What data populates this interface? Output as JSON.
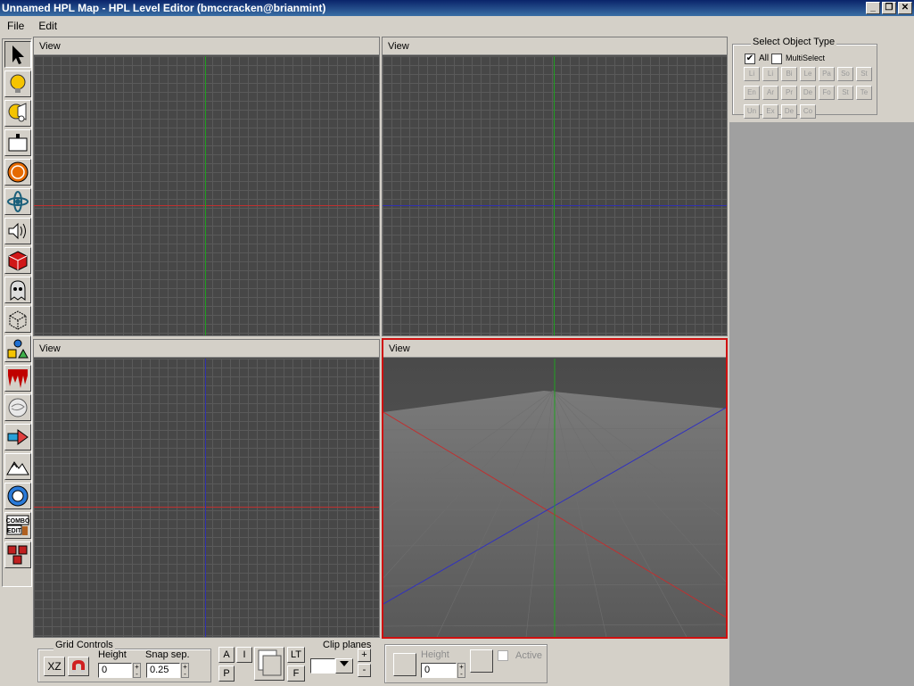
{
  "window": {
    "title": "Unnamed HPL Map - HPL Level Editor  (bmccracken@brianmint)"
  },
  "menu": {
    "items": [
      "File",
      "Edit"
    ]
  },
  "toolbox": {
    "tools": [
      "select",
      "light",
      "spotlight",
      "billboard",
      "particle-flare",
      "particle-system",
      "sound",
      "static-object",
      "entity",
      "area",
      "primitive",
      "decal",
      "fog",
      "arrow",
      "terrain",
      "combo",
      "compound"
    ]
  },
  "viewports": [
    {
      "label": "View",
      "type": "orthographic",
      "axes": {
        "horizontal": "#c03030",
        "vertical": "#20a020"
      }
    },
    {
      "label": "View",
      "type": "orthographic",
      "axes": {
        "horizontal": "#3030b0",
        "vertical": "#20a020"
      }
    },
    {
      "label": "View",
      "type": "orthographic",
      "axes": {
        "horizontal": "#c03030",
        "vertical": "#3030b0"
      }
    },
    {
      "label": "View",
      "type": "perspective",
      "selected": true
    }
  ],
  "object_type": {
    "title": "Select Object Type",
    "all_label": "All",
    "all_checked": true,
    "multiselect_label": "MultiSelect",
    "multiselect_checked": false,
    "buttons_row1": [
      "Li",
      "Li",
      "Bi",
      "Le",
      "Pa",
      "So",
      "St"
    ],
    "buttons_row2": [
      "En",
      "Ar",
      "Pr",
      "De",
      "Fo",
      "St",
      "Te"
    ],
    "buttons_row3": [
      "Un",
      "Ex",
      "De",
      "Co"
    ]
  },
  "grid_controls": {
    "title": "Grid Controls",
    "plane_button": "XZ",
    "height_label": "Height",
    "height_value": "0",
    "snap_label": "Snap sep.",
    "snap_value": "0.25",
    "btn_a": "A",
    "btn_i": "I",
    "btn_p": "P",
    "btn_lt": "LT",
    "btn_f": "F"
  },
  "clip_planes": {
    "title": "Clip planes",
    "add": "+",
    "remove": "-",
    "height_label": "Height",
    "height_value": "0",
    "active_label": "Active"
  },
  "colors": {
    "selected_border": "#d01010",
    "title_bar": "#0a246a"
  }
}
